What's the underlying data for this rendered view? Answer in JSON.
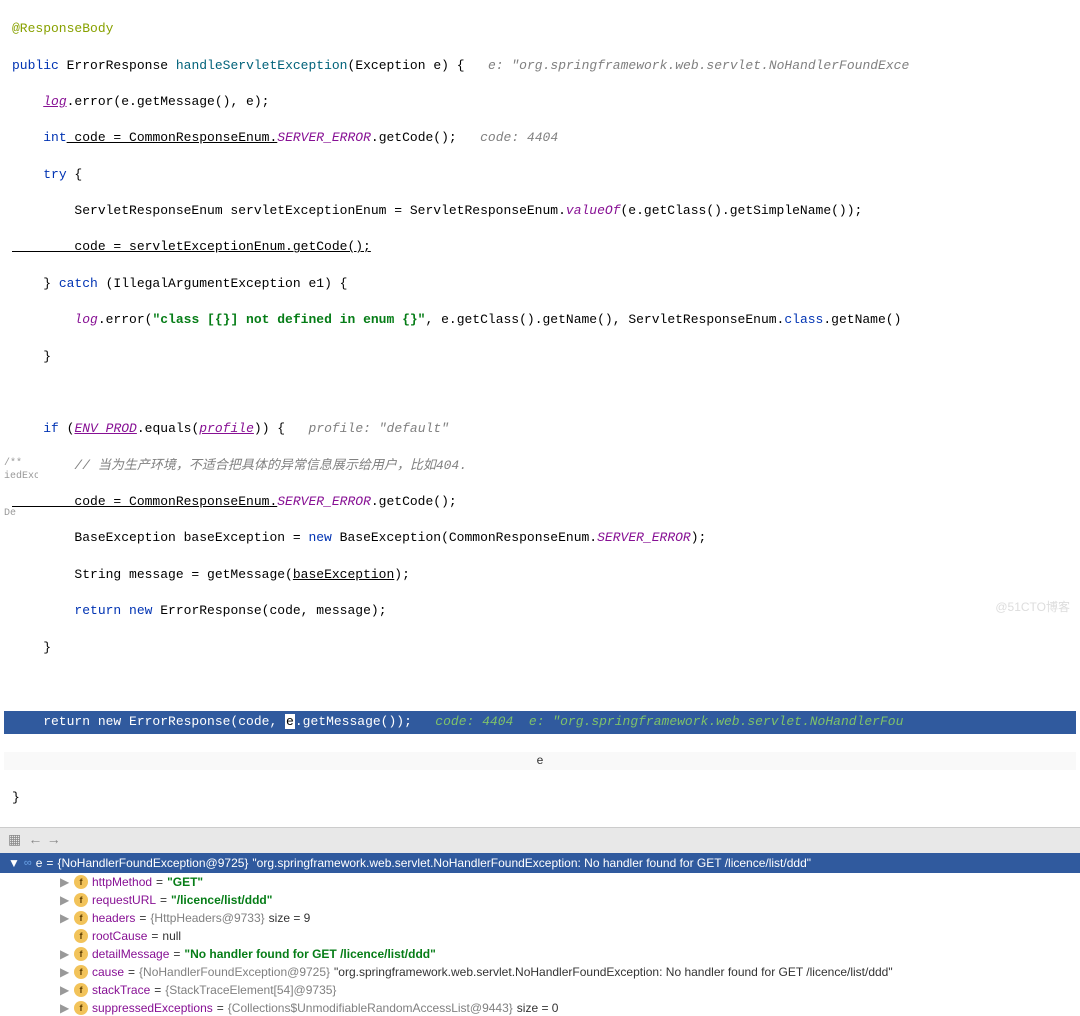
{
  "code": {
    "annotation": "@ResponseBody",
    "kw_public": "public",
    "ret_type": "ErrorResponse",
    "method_name": "handleServletException",
    "param_type": "Exception",
    "param_name": "e",
    "lbrace": " {",
    "inline_hint1": "   e: \"org.springframework.web.servlet.NoHandlerFoundExce",
    "log_error1": "log",
    "log_call1": ".error(e.getMessage(), e);",
    "kw_int": "int",
    "code_var": " code = CommonResponseEnum.",
    "server_error": "SERVER_ERROR",
    "getcode": ".getCode();",
    "inline_hint2": "   code: 4404",
    "kw_try": "try",
    "try_brace": " {",
    "line_servlet": "        ServletResponseEnum servletExceptionEnum = ServletResponseEnum.",
    "valueof": "valueOf",
    "valueof_args": "(e.getClass().getSimpleName());",
    "code_assign": "        code = servletExceptionEnum.getCode();",
    "catch_line": "    } ",
    "kw_catch": "catch",
    "catch_args": " (IllegalArgumentException e1) {",
    "log_error2a": "        ",
    "log2": "log",
    "log_error2b": ".error(",
    "log_str": "\"class [{}] not defined in enum {}\"",
    "log_error2c": ", e.getClass().getName(), ServletResponseEnum.",
    "kw_class": "class",
    "log_error2d": ".getName()",
    "close_brace1": "    }",
    "kw_if": "if",
    "if_cond1": " (",
    "env_prod": "ENV_PROD",
    "if_cond2": ".equals(",
    "profile": "profile",
    "if_cond3": ")) {",
    "inline_hint3": "   profile: \"default\"",
    "comment_cn": "        // 当为生产环境，不适合把具体的异常信息展示给用户，比如404.",
    "code_assign2": "        code = CommonResponseEnum.",
    "getcode2": ".getCode();",
    "base_exc": "        BaseException baseException = ",
    "kw_new": "new",
    "base_exc2": " BaseException(CommonResponseEnum.",
    "base_exc3": ");",
    "msg_line": "        String message = getMessage(",
    "base_exc_var": "baseException",
    "msg_line2": ");",
    "ret1a": "        ",
    "kw_return": "return",
    "ret1b": " ",
    "ret1c": " ErrorResponse(code, message);",
    "close_brace2": "    }",
    "highlighted_prefix": "    return new ErrorResponse(code, ",
    "highlighted_e": "e",
    "highlighted_suffix": ".getMessage());",
    "hl_hint": "   code: 4404  e: \"org.springframework.web.servlet.NoHandlerFou",
    "final_brace": "}"
  },
  "tooltip_char": "e",
  "gutter": {
    "item1": "/**",
    "item2": "iedExc",
    "item3": "De"
  },
  "debug": {
    "header_var": "e",
    "header_eq": " = ",
    "header_obj": "{NoHandlerFoundException@9725}",
    "header_str": " \"org.springframework.web.servlet.NoHandlerFoundException: No handler found for GET /licence/list/ddd\"",
    "rows": [
      {
        "expand": "▶",
        "name": "httpMethod",
        "value_str": "\"GET\""
      },
      {
        "expand": "▶",
        "name": "requestURL",
        "value_str": "\"/licence/list/ddd\""
      },
      {
        "expand": "▶",
        "name": "headers",
        "value_obj": "{HttpHeaders@9733}",
        "size": "  size = 9"
      },
      {
        "expand": "",
        "name": "rootCause",
        "value_plain": "null"
      },
      {
        "expand": "▶",
        "name": "detailMessage",
        "value_str": "\"No handler found for GET /licence/list/ddd\""
      },
      {
        "expand": "▶",
        "name": "cause",
        "value_obj": "{NoHandlerFoundException@9725}",
        "tail": " \"org.springframework.web.servlet.NoHandlerFoundException: No handler found for GET /licence/list/ddd\""
      },
      {
        "expand": "▶",
        "name": "stackTrace",
        "value_obj": "{StackTraceElement[54]@9735}"
      },
      {
        "expand": "▶",
        "name": "suppressedExceptions",
        "value_obj": "{Collections$UnmodifiableRandomAccessList@9443}",
        "size": "  size = 0"
      }
    ]
  },
  "watermark": "@51CTO博客"
}
